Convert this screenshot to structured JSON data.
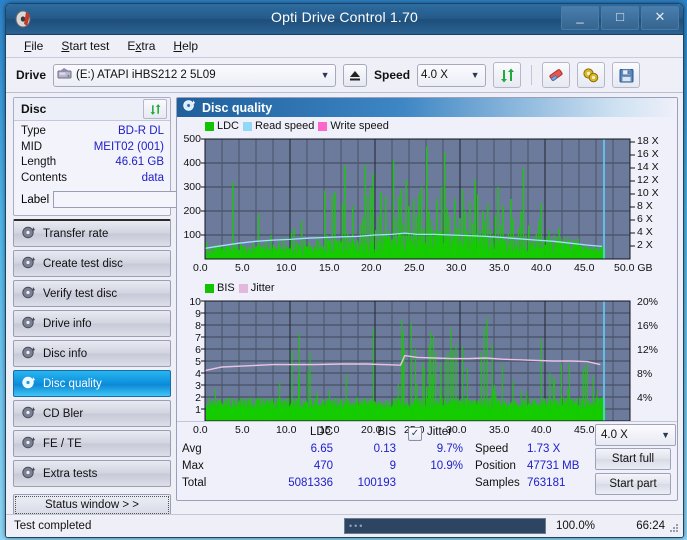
{
  "window": {
    "title": "Opti Drive Control 1.70",
    "app_icon": "disc-icon",
    "minimize": "_",
    "maximize": "□",
    "close": "✕"
  },
  "menu": {
    "items": [
      {
        "label": "File",
        "accel": "F"
      },
      {
        "label": "Start test",
        "accel": "S"
      },
      {
        "label": "Extra",
        "accel": "x"
      },
      {
        "label": "Help",
        "accel": "H"
      }
    ]
  },
  "toolbar": {
    "drive_label": "Drive",
    "drive_value": "(E:)  ATAPI iHBS212  2 5L09",
    "eject_icon": "eject-icon",
    "speed_label": "Speed",
    "speed_value": "4.0 X",
    "refresh_icon": "refresh-icon",
    "erase_icon": "eraser-icon",
    "settings_icon": "gear-icon",
    "save_icon": "save-icon"
  },
  "sidebar": {
    "disc_group": {
      "title": "Disc",
      "refresh_icon": "refresh-icon",
      "rows": [
        {
          "key": "Type",
          "value": "BD-R DL"
        },
        {
          "key": "MID",
          "value": "MEIT02 (001)"
        },
        {
          "key": "Length",
          "value": "46.61 GB"
        },
        {
          "key": "Contents",
          "value": "data"
        }
      ],
      "label_key": "Label",
      "label_value": "",
      "label_placeholder": "",
      "disc_icon": "cd-icon"
    },
    "nav": [
      {
        "label": "Transfer rate",
        "icon": "disc-icon",
        "active": false
      },
      {
        "label": "Create test disc",
        "icon": "disc-icon",
        "active": false
      },
      {
        "label": "Verify test disc",
        "icon": "disc-icon",
        "active": false
      },
      {
        "label": "Drive info",
        "icon": "disc-icon",
        "active": false
      },
      {
        "label": "Disc info",
        "icon": "disc-icon",
        "active": false
      },
      {
        "label": "Disc quality",
        "icon": "disc-icon",
        "active": true
      },
      {
        "label": "CD Bler",
        "icon": "disc-icon",
        "active": false
      },
      {
        "label": "FE / TE",
        "icon": "disc-icon",
        "active": false
      },
      {
        "label": "Extra tests",
        "icon": "disc-icon",
        "active": false
      }
    ],
    "status_window_button": "Status window > >"
  },
  "panel": {
    "title": "Disc quality",
    "icon": "disc-icon"
  },
  "chart_data": [
    {
      "type": "bar",
      "name": "ldc-chart",
      "title": "",
      "xlabel": "GB",
      "ylabel": "",
      "x_ticks": [
        "0.0",
        "5.0",
        "10.0",
        "15.0",
        "20.0",
        "25.0",
        "30.0",
        "35.0",
        "40.0",
        "45.0",
        "50.0 GB"
      ],
      "xlim": [
        0,
        50
      ],
      "y_left_ticks": [
        "100",
        "200",
        "300",
        "400",
        "500"
      ],
      "ylim": [
        0,
        500
      ],
      "y_right_ticks": [
        "2 X",
        "4 X",
        "6 X",
        "8 X",
        "10 X",
        "12 X",
        "14 X",
        "16 X",
        "18 X"
      ],
      "ylim_right": [
        0,
        19
      ],
      "grid": true,
      "legend_position": "top-left",
      "legend": [
        {
          "label": "LDC",
          "color": "#12c400"
        },
        {
          "label": "Read speed",
          "color": "#8fd8f8"
        },
        {
          "label": "Write speed",
          "color": "#ff66cc"
        }
      ],
      "series": [
        {
          "name": "LDC",
          "color": "#12c400",
          "type": "bar",
          "x": [
            0.2,
            0.5,
            0.8,
            1.1,
            1.4,
            1.7,
            2.0,
            2.3,
            2.6,
            2.9,
            3.2,
            3.5,
            3.8,
            4.1,
            4.4,
            4.7,
            5.0,
            5.3,
            5.6,
            5.9,
            6.2,
            6.5,
            6.8,
            7.1,
            7.4,
            7.7,
            8.0,
            8.3,
            8.6,
            8.9,
            9.2,
            9.5,
            9.8,
            10.1,
            10.4,
            10.7,
            11.0,
            11.3,
            11.6,
            11.9,
            12.2,
            12.5,
            12.8,
            13.1,
            13.4,
            13.7,
            14.0,
            14.3,
            14.6,
            14.9,
            15.2,
            15.5,
            15.8,
            16.1,
            16.4,
            16.7,
            17.0,
            17.3,
            17.6,
            17.9,
            18.2,
            18.5,
            18.8,
            19.1,
            19.4,
            19.7,
            20.0,
            20.3,
            20.6,
            20.9,
            21.2,
            21.5,
            21.8,
            22.1,
            22.4,
            22.7,
            23.0,
            23.3,
            23.6,
            23.9,
            24.2,
            24.5,
            24.8,
            25.1,
            25.4,
            25.7,
            26.0,
            26.3,
            26.6,
            26.9,
            27.2,
            27.5,
            27.8,
            28.1,
            28.4,
            28.7,
            29.0,
            29.3,
            29.6,
            29.9,
            30.2,
            30.5,
            30.8,
            31.1,
            31.4,
            31.7,
            32.0,
            32.3,
            32.6,
            32.9,
            33.2,
            33.5,
            33.8,
            34.1,
            34.4,
            34.7,
            35.0,
            35.3,
            35.6,
            35.9,
            36.2,
            36.5,
            36.8,
            37.1,
            37.4,
            37.7,
            38.0,
            38.3,
            38.6,
            38.9,
            39.2,
            39.5,
            39.8,
            40.1,
            40.4,
            40.7,
            41.0,
            41.3,
            41.6,
            41.9,
            42.2,
            42.5,
            42.8,
            43.1,
            43.4,
            43.7,
            44.0,
            44.3,
            44.6,
            44.9,
            45.2,
            45.5,
            45.8,
            46.1,
            46.4,
            46.7
          ],
          "values": [
            70,
            45,
            30,
            60,
            35,
            25,
            40,
            30,
            55,
            35,
            320,
            60,
            40,
            70,
            35,
            50,
            45,
            30,
            65,
            40,
            185,
            55,
            40,
            80,
            45,
            100,
            60,
            40,
            75,
            50,
            90,
            55,
            45,
            110,
            130,
            70,
            60,
            160,
            80,
            50,
            70,
            55,
            45,
            90,
            75,
            60,
            285,
            100,
            70,
            265,
            280,
            60,
            80,
            230,
            390,
            110,
            90,
            220,
            60,
            70,
            140,
            170,
            390,
            260,
            300,
            355,
            120,
            180,
            280,
            100,
            260,
            90,
            70,
            410,
            170,
            260,
            290,
            150,
            330,
            220,
            90,
            250,
            180,
            270,
            300,
            130,
            470,
            200,
            160,
            120,
            250,
            100,
            300,
            445,
            210,
            180,
            90,
            250,
            130,
            170,
            290,
            200,
            110,
            240,
            150,
            330,
            270,
            120,
            200,
            160,
            230,
            120,
            100,
            180,
            300,
            140,
            220,
            80,
            110,
            250,
            170,
            90,
            130,
            200,
            380,
            100,
            140,
            70,
            90,
            110,
            160,
            230,
            70,
            90,
            120,
            60,
            100,
            80,
            130,
            70,
            90,
            60,
            80,
            50,
            70,
            60,
            55,
            45,
            50,
            40,
            45,
            35,
            40,
            30,
            35,
            25
          ]
        },
        {
          "name": "Read speed",
          "color": "#8fd8f8",
          "type": "line",
          "x": [
            0,
            2,
            4,
            6,
            8,
            10,
            12,
            14,
            16,
            18,
            20,
            22,
            23.5,
            25,
            27,
            29,
            31,
            33,
            35,
            37,
            39,
            41,
            43,
            45,
            46.7
          ],
          "values_x_axis": [
            1.7,
            2.1,
            2.5,
            2.8,
            3.0,
            3.1,
            3.3,
            3.4,
            3.5,
            3.6,
            3.8,
            3.9,
            4.1,
            3.9,
            3.9,
            3.8,
            3.7,
            3.6,
            3.4,
            3.2,
            3.0,
            2.8,
            2.5,
            2.2,
            2.0
          ]
        }
      ],
      "cursor_line_x": 47.0,
      "cursor_color": "#5fd0f8"
    },
    {
      "type": "bar",
      "name": "bis-jitter-chart",
      "title": "",
      "xlabel": "GB",
      "x_ticks": [
        "0.0",
        "5.0",
        "10.0",
        "15.0",
        "20.0",
        "25.0",
        "30.0",
        "35.0",
        "40.0",
        "45.0",
        "50.0 GB"
      ],
      "xlim": [
        0,
        50
      ],
      "y_left_ticks": [
        "1",
        "2",
        "3",
        "4",
        "5",
        "6",
        "7",
        "8",
        "9",
        "10"
      ],
      "ylim": [
        0,
        10
      ],
      "y_right_ticks": [
        "4%",
        "8%",
        "12%",
        "16%",
        "20%"
      ],
      "ylim_right": [
        0,
        20
      ],
      "grid": true,
      "legend_position": "top-left",
      "legend": [
        {
          "label": "BIS",
          "color": "#12c400"
        },
        {
          "label": "Jitter",
          "color": "#e3b8dd"
        }
      ],
      "series": [
        {
          "name": "BIS",
          "color": "#12c400",
          "type": "bar",
          "baseline": 1.0,
          "note": "dense low bars around 1-2 with spikes to 6-9 mainly after 23 GB"
        },
        {
          "name": "Jitter",
          "color": "#e3b8dd",
          "type": "line",
          "x": [
            0,
            2,
            5,
            8,
            10,
            13,
            16,
            19,
            21,
            23,
            23.5,
            25,
            27,
            29,
            31,
            33,
            35,
            37,
            39,
            41,
            43,
            45,
            46.5
          ],
          "values_pct": [
            8.4,
            9.0,
            9.2,
            9.4,
            9.4,
            9.4,
            9.5,
            9.5,
            9.4,
            9.3,
            10.9,
            10.6,
            10.5,
            10.4,
            10.4,
            10.5,
            10.3,
            10.2,
            10.1,
            10.0,
            10.0,
            9.9,
            9.4
          ]
        }
      ],
      "cursor_line_x": 47.0,
      "cursor_color": "#5fd0f8"
    }
  ],
  "stats": {
    "col_headers": [
      "LDC",
      "BIS"
    ],
    "row_labels": [
      "Avg",
      "Max",
      "Total"
    ],
    "ldc": {
      "avg": "6.65",
      "max": "470",
      "total": "5081336"
    },
    "bis": {
      "avg": "0.13",
      "max": "9",
      "total": "100193"
    },
    "jitter": {
      "label": "Jitter",
      "checked": true,
      "avg": "9.7%",
      "max": "10.9%"
    },
    "right": {
      "speed_label": "Speed",
      "speed_value": "1.73 X",
      "position_label": "Position",
      "position_value": "47731 MB",
      "samples_label": "Samples",
      "samples_value": "763181",
      "speed_select": "4.0 X",
      "start_full": "Start full",
      "start_part": "Start part"
    }
  },
  "statusbar": {
    "message": "Test completed",
    "progress_pct": "100.0%",
    "progress_value": 100,
    "elapsed": "66:24"
  }
}
